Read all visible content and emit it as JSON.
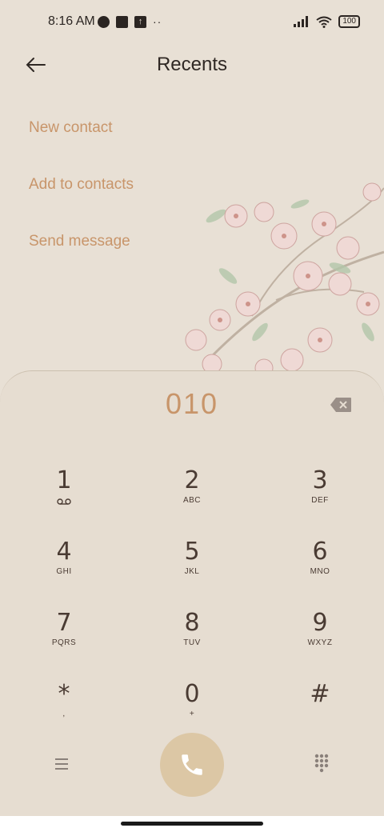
{
  "status": {
    "time": "8:16 AM",
    "overflow_dots": "··",
    "battery": "100"
  },
  "header": {
    "title": "Recents"
  },
  "actions": [
    {
      "label": "New contact"
    },
    {
      "label": "Add to contacts"
    },
    {
      "label": "Send message"
    }
  ],
  "dialer": {
    "number": "010",
    "keys": [
      {
        "digit": "1",
        "letters": ""
      },
      {
        "digit": "2",
        "letters": "ABC"
      },
      {
        "digit": "3",
        "letters": "DEF"
      },
      {
        "digit": "4",
        "letters": "GHI"
      },
      {
        "digit": "5",
        "letters": "JKL"
      },
      {
        "digit": "6",
        "letters": "MNO"
      },
      {
        "digit": "7",
        "letters": "PQRS"
      },
      {
        "digit": "8",
        "letters": "TUV"
      },
      {
        "digit": "9",
        "letters": "WXYZ"
      },
      {
        "digit": "*",
        "letters": ","
      },
      {
        "digit": "0",
        "letters": "+"
      },
      {
        "digit": "#",
        "letters": ""
      }
    ]
  },
  "colors": {
    "accent": "#c8956a",
    "background": "#e8e0d5",
    "call_button": "#dcc7a5"
  },
  "icons": {
    "back": "arrow-left-icon",
    "backspace": "backspace-icon",
    "voicemail": "voicemail-icon",
    "menu": "menu-icon",
    "call": "phone-icon",
    "dialpad": "dialpad-icon"
  }
}
